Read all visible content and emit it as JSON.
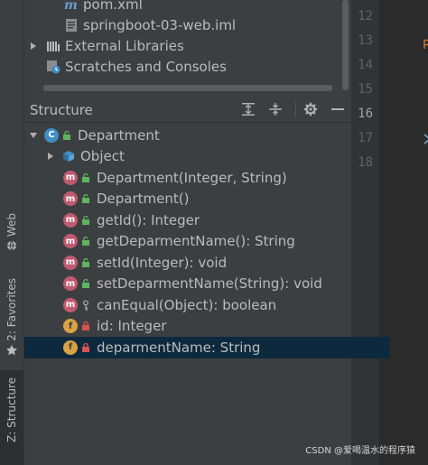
{
  "left_stripe": {
    "tabs": [
      {
        "label": "Web",
        "icon": "web-icon",
        "active": false
      },
      {
        "label": "2: Favorites",
        "icon": "star-icon",
        "active": false
      },
      {
        "label": "Z: Structure",
        "icon": "structure-icon",
        "active": true
      }
    ]
  },
  "project_tree": {
    "items": [
      {
        "label": "pom.xml",
        "icon": "maven-icon"
      },
      {
        "label": "springboot-03-web.iml",
        "icon": "iml-file-icon"
      },
      {
        "label": "External Libraries",
        "icon": "library-icon"
      },
      {
        "label": "Scratches and Consoles",
        "icon": "scratches-icon"
      }
    ]
  },
  "editor": {
    "line_numbers": [
      "12",
      "13",
      "14",
      "15",
      "16",
      "17",
      "18"
    ],
    "current_line": "16"
  },
  "structure": {
    "title": "Structure",
    "toolbar": {
      "expand_all": "expand-all-icon",
      "collapse_all": "collapse-all-icon",
      "settings": "gear-icon",
      "hide": "minimize-icon"
    },
    "root": {
      "label": "Department",
      "kind": "C",
      "access": "public"
    },
    "nodes": [
      {
        "label": "Object",
        "kind": "object",
        "access": "",
        "collapsed": true
      },
      {
        "label": "Department(Integer, String)",
        "kind": "m",
        "access": "public"
      },
      {
        "label": "Department()",
        "kind": "m",
        "access": "public"
      },
      {
        "label": "getId(): Integer",
        "kind": "m",
        "access": "public"
      },
      {
        "label": "getDeparmentName(): String",
        "kind": "m",
        "access": "public"
      },
      {
        "label": "setId(Integer): void",
        "kind": "m",
        "access": "public"
      },
      {
        "label": "setDeparmentName(String): void",
        "kind": "m",
        "access": "public"
      },
      {
        "label": "canEqual(Object): boolean",
        "kind": "m",
        "access": "protected"
      },
      {
        "label": "id: Integer",
        "kind": "f",
        "access": "private"
      },
      {
        "label": "deparmentName: String",
        "kind": "f",
        "access": "private",
        "selected": true
      }
    ]
  },
  "watermark": "CSDN @爱喝温水的程序猿",
  "colors": {
    "panel_bg": "#3c3f41",
    "editor_bg": "#2b2b2b",
    "selection": "#0d293e",
    "class_badge": "#3d8fc6",
    "method_badge": "#c05a71",
    "field_badge": "#d9a343",
    "public_lock": "#5fb55f",
    "private_lock": "#d9534f"
  }
}
